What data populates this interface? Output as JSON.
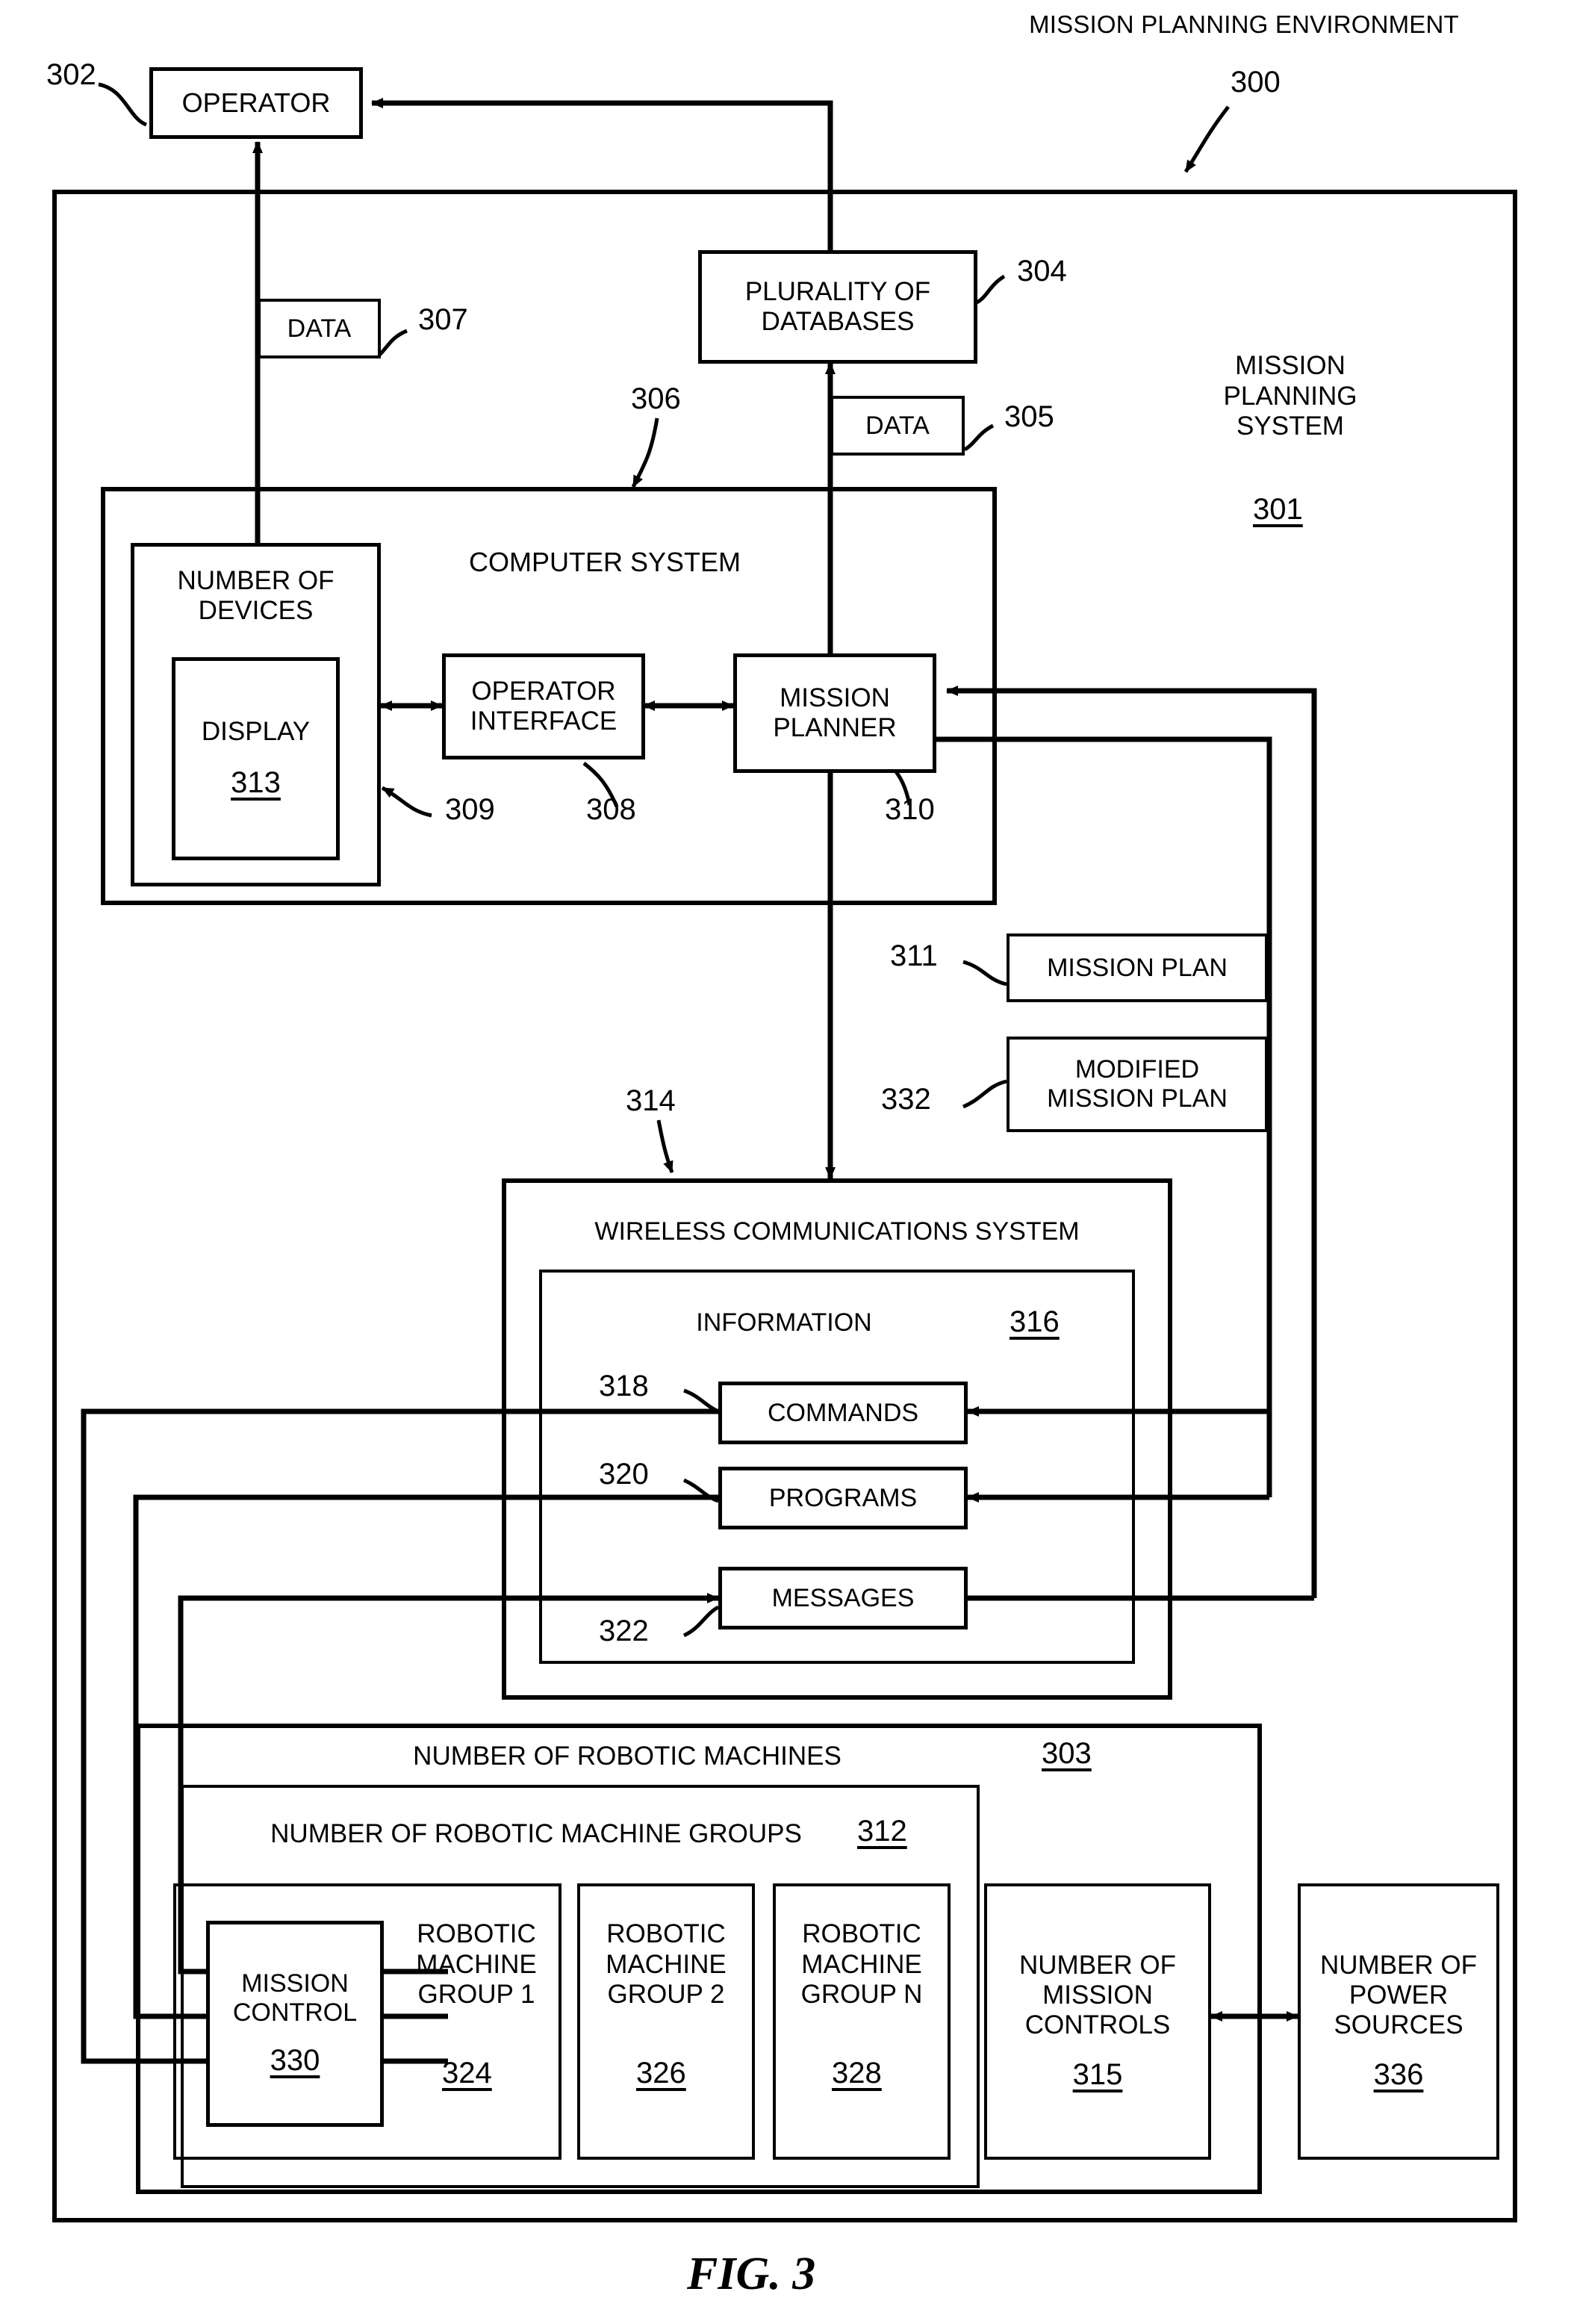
{
  "figure": {
    "caption": "FIG. 3",
    "title": "MISSION PLANNING ENVIRONMENT",
    "title_ref": "300"
  },
  "boxes": {
    "operator": {
      "label": "OPERATOR",
      "ref": "302"
    },
    "data_operator": {
      "label": "DATA",
      "ref": "307"
    },
    "databases": {
      "label": "PLURALITY OF\nDATABASES",
      "ref": "304"
    },
    "data_databases": {
      "label": "DATA",
      "ref": "305"
    },
    "mission_planning_system": {
      "label": "MISSION\nPLANNING\nSYSTEM",
      "ref": "301"
    },
    "computer_system": {
      "label": "COMPUTER SYSTEM",
      "ref": "306"
    },
    "number_of_devices": {
      "label": "NUMBER OF\nDEVICES",
      "ref": "309"
    },
    "display": {
      "label": "DISPLAY",
      "ref": "313"
    },
    "operator_interface": {
      "label": "OPERATOR\nINTERFACE",
      "ref": "308"
    },
    "mission_planner": {
      "label": "MISSION\nPLANNER",
      "ref": "310"
    },
    "mission_plan": {
      "label": "MISSION PLAN",
      "ref": "311"
    },
    "modified_mission_plan": {
      "label": "MODIFIED\nMISSION PLAN",
      "ref": "332"
    },
    "wireless_communications_system": {
      "label": "WIRELESS COMMUNICATIONS SYSTEM",
      "ref": "314"
    },
    "information": {
      "label": "INFORMATION",
      "ref": "316"
    },
    "commands": {
      "label": "COMMANDS",
      "ref": "318"
    },
    "programs": {
      "label": "PROGRAMS",
      "ref": "320"
    },
    "messages": {
      "label": "MESSAGES",
      "ref": "322"
    },
    "number_of_robotic_machines": {
      "label": "NUMBER OF ROBOTIC MACHINES",
      "ref": "303"
    },
    "number_of_robotic_machine_groups": {
      "label": "NUMBER OF ROBOTIC MACHINE GROUPS",
      "ref": "312"
    },
    "mission_control": {
      "label": "MISSION\nCONTROL",
      "ref": "330"
    },
    "robotic_machine_group_1": {
      "label": "ROBOTIC\nMACHINE\nGROUP 1",
      "ref": "324"
    },
    "robotic_machine_group_2": {
      "label": "ROBOTIC\nMACHINE\nGROUP 2",
      "ref": "326"
    },
    "robotic_machine_group_n": {
      "label": "ROBOTIC\nMACHINE\nGROUP N",
      "ref": "328"
    },
    "number_of_mission_controls": {
      "label": "NUMBER OF\nMISSION\nCONTROLS",
      "ref": "315"
    },
    "number_of_power_sources": {
      "label": "NUMBER OF\nPOWER\nSOURCES",
      "ref": "336"
    }
  }
}
